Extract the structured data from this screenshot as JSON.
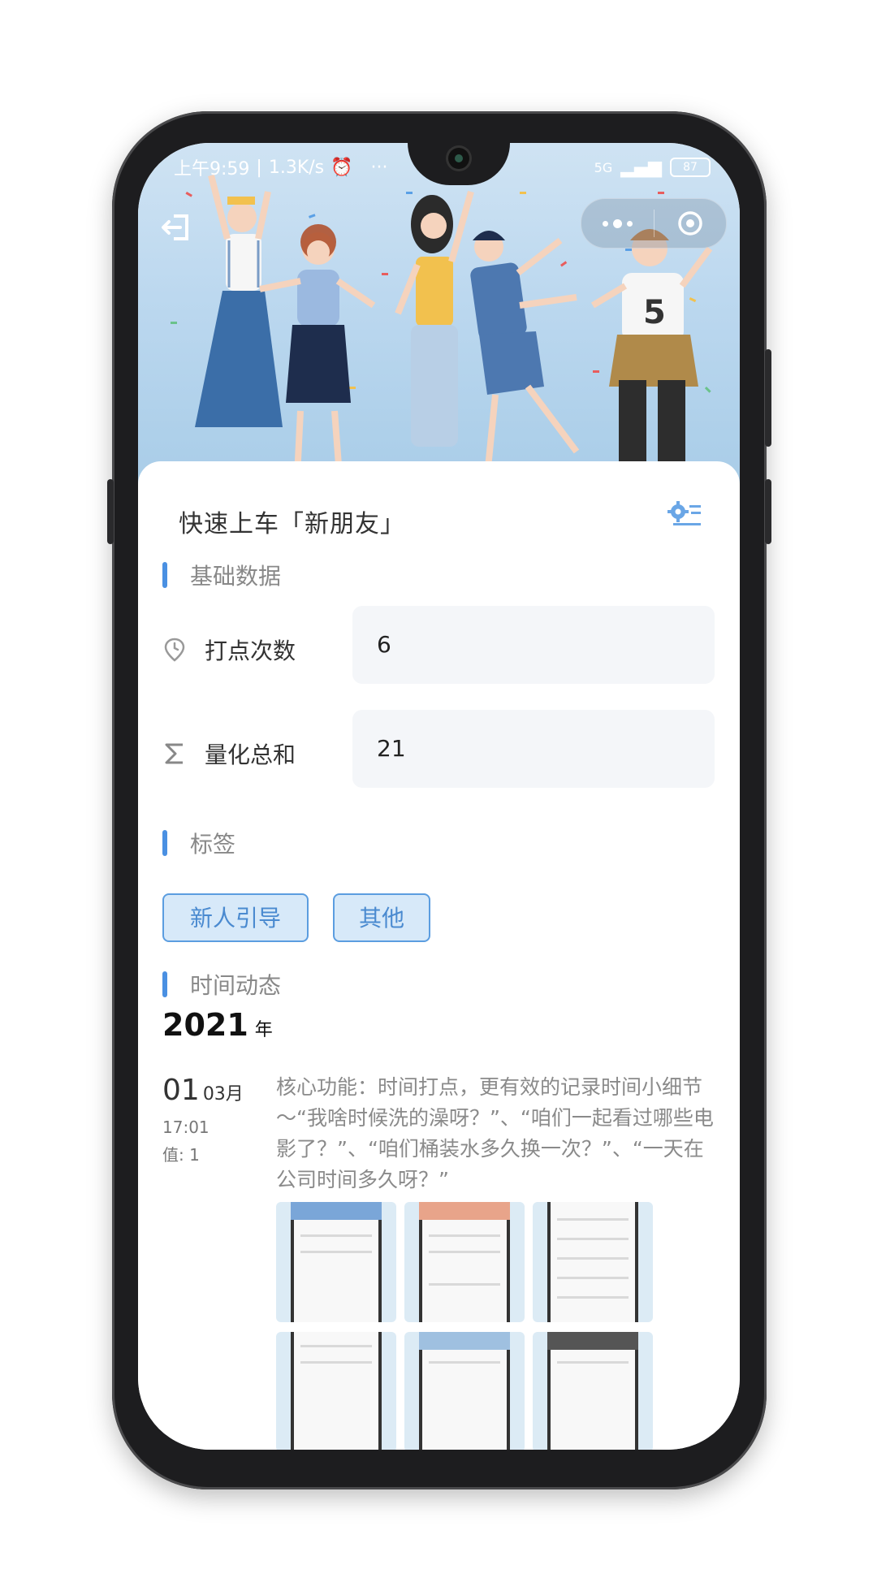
{
  "status_bar": {
    "time": "上午9:59",
    "speed": "1.3K/s",
    "more": "···",
    "network": "5G",
    "battery": "87"
  },
  "header": {
    "back_icon": "exit-icon",
    "more_icon": "more-dots-icon",
    "close_icon": "target-circle-icon"
  },
  "card": {
    "title": "快速上车「新朋友」",
    "settings_icon": "gear-list-icon"
  },
  "sections": {
    "basic": "基础数据",
    "tags": "标签",
    "timeline": "时间动态"
  },
  "stats": [
    {
      "label": "打点次数",
      "value": "6",
      "icon": "clock-pin-icon"
    },
    {
      "label": "量化总和",
      "value": "21",
      "icon": "sigma-icon"
    }
  ],
  "tags": [
    "新人引导",
    "其他"
  ],
  "timeline": {
    "year": "2021",
    "year_unit": "年",
    "entry": {
      "day": "01",
      "month": "03月",
      "time": "17:01",
      "value": "值: 1",
      "text": "核心功能：时间打点，更有效的记录时间小细节～“我啥时候洗的澡呀？”、“咱们一起看过哪些电影了？”、“咱们桶装水多久换一次？”、“一天在公司时间多久呀？”"
    }
  },
  "colors": {
    "accent": "#4a90e2",
    "tag_bg": "#d7e9f9",
    "tag_border": "#5b9de0",
    "input_bg": "#f4f6f9"
  }
}
